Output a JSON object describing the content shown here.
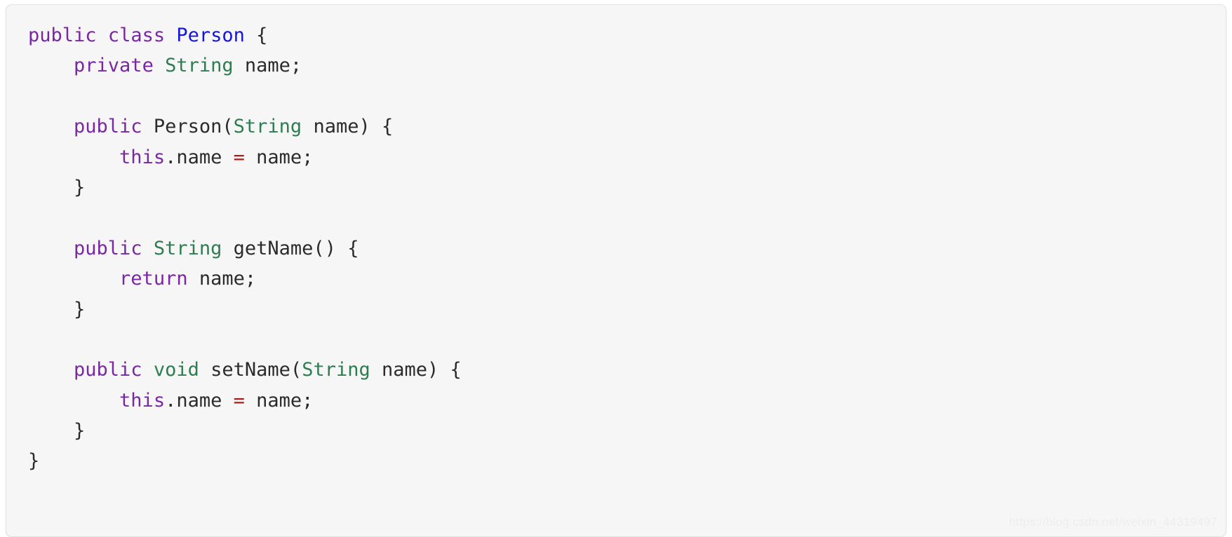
{
  "panel": {
    "background_color": "#f6f6f6",
    "border_color": "#e3e3e3",
    "language": "java"
  },
  "theme": {
    "keyword_color": "#7928a1",
    "classname_color": "#1515e0",
    "type_color": "#2e7d51",
    "plain_color": "#2b2b2b",
    "operator_color": "#a61d1d",
    "watermark_color": "#ededed"
  },
  "watermark": {
    "text": "https://blog.csdn.net/weixin_44319497"
  },
  "code": {
    "lines": [
      {
        "index": 1,
        "text": "public class Person {",
        "tokens": [
          {
            "t": "public",
            "k": "keyword"
          },
          {
            "t": " ",
            "k": "plain"
          },
          {
            "t": "class",
            "k": "keyword"
          },
          {
            "t": " ",
            "k": "plain"
          },
          {
            "t": "Person",
            "k": "classname"
          },
          {
            "t": " {",
            "k": "punct"
          }
        ]
      },
      {
        "index": 2,
        "text": "    private String name;",
        "tokens": [
          {
            "t": "    ",
            "k": "plain"
          },
          {
            "t": "private",
            "k": "keyword"
          },
          {
            "t": " ",
            "k": "plain"
          },
          {
            "t": "String",
            "k": "type"
          },
          {
            "t": " name;",
            "k": "plain"
          }
        ]
      },
      {
        "index": 3,
        "text": "",
        "tokens": []
      },
      {
        "index": 4,
        "text": "    public Person(String name) {",
        "tokens": [
          {
            "t": "    ",
            "k": "plain"
          },
          {
            "t": "public",
            "k": "keyword"
          },
          {
            "t": " ",
            "k": "plain"
          },
          {
            "t": "Person",
            "k": "plain"
          },
          {
            "t": "(",
            "k": "punct"
          },
          {
            "t": "String",
            "k": "type"
          },
          {
            "t": " name) {",
            "k": "plain"
          }
        ]
      },
      {
        "index": 5,
        "text": "        this.name = name;",
        "tokens": [
          {
            "t": "        ",
            "k": "plain"
          },
          {
            "t": "this",
            "k": "keyword"
          },
          {
            "t": ".name ",
            "k": "plain"
          },
          {
            "t": "=",
            "k": "operator"
          },
          {
            "t": " name;",
            "k": "plain"
          }
        ]
      },
      {
        "index": 6,
        "text": "    }",
        "tokens": [
          {
            "t": "    }",
            "k": "punct"
          }
        ]
      },
      {
        "index": 7,
        "text": "",
        "tokens": []
      },
      {
        "index": 8,
        "text": "    public String getName() {",
        "tokens": [
          {
            "t": "    ",
            "k": "plain"
          },
          {
            "t": "public",
            "k": "keyword"
          },
          {
            "t": " ",
            "k": "plain"
          },
          {
            "t": "String",
            "k": "type"
          },
          {
            "t": " getName() {",
            "k": "plain"
          }
        ]
      },
      {
        "index": 9,
        "text": "        return name;",
        "tokens": [
          {
            "t": "        ",
            "k": "plain"
          },
          {
            "t": "return",
            "k": "keyword"
          },
          {
            "t": " name;",
            "k": "plain"
          }
        ]
      },
      {
        "index": 10,
        "text": "    }",
        "tokens": [
          {
            "t": "    }",
            "k": "punct"
          }
        ]
      },
      {
        "index": 11,
        "text": "",
        "tokens": []
      },
      {
        "index": 12,
        "text": "    public void setName(String name) {",
        "tokens": [
          {
            "t": "    ",
            "k": "plain"
          },
          {
            "t": "public",
            "k": "keyword"
          },
          {
            "t": " ",
            "k": "plain"
          },
          {
            "t": "void",
            "k": "type"
          },
          {
            "t": " setName",
            "k": "plain"
          },
          {
            "t": "(",
            "k": "punct"
          },
          {
            "t": "String",
            "k": "type"
          },
          {
            "t": " name) {",
            "k": "plain"
          }
        ]
      },
      {
        "index": 13,
        "text": "        this.name = name;",
        "tokens": [
          {
            "t": "        ",
            "k": "plain"
          },
          {
            "t": "this",
            "k": "keyword"
          },
          {
            "t": ".name ",
            "k": "plain"
          },
          {
            "t": "=",
            "k": "operator"
          },
          {
            "t": " name;",
            "k": "plain"
          }
        ]
      },
      {
        "index": 14,
        "text": "    }",
        "tokens": [
          {
            "t": "    }",
            "k": "punct"
          }
        ]
      },
      {
        "index": 15,
        "text": "}",
        "tokens": [
          {
            "t": "}",
            "k": "punct"
          }
        ]
      }
    ]
  }
}
